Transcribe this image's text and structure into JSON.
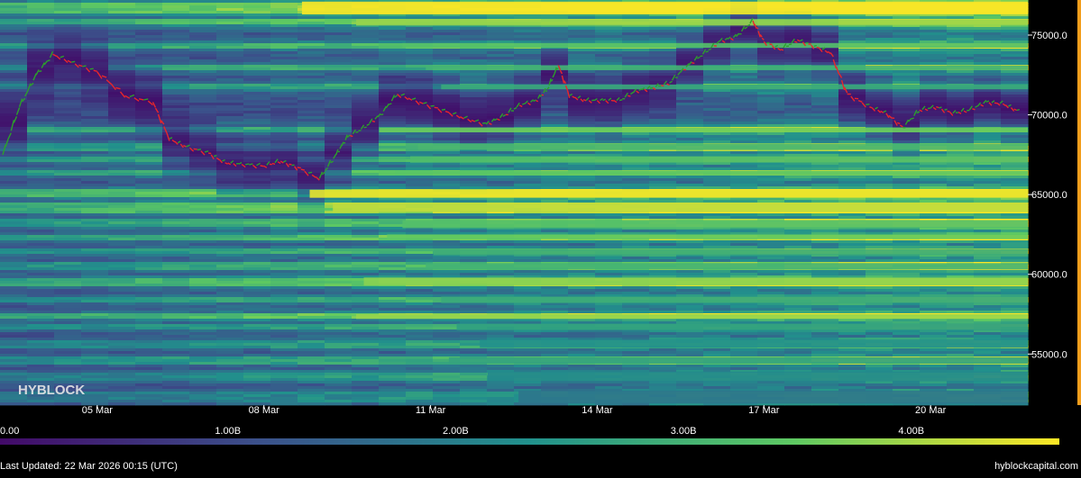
{
  "watermark": "HYBLOCK",
  "footer": {
    "last_updated": "Last Updated: 22 Mar 2026 00:15 (UTC)",
    "site": "hyblockcapital.com"
  },
  "chart_data": {
    "type": "heatmap",
    "title": "",
    "xlabel": "",
    "ylabel": "",
    "x_ticks": [
      "05 Mar",
      "08 Mar",
      "11 Mar",
      "14 Mar",
      "17 Mar",
      "20 Mar"
    ],
    "x_range_days": [
      3.25,
      21.75
    ],
    "y_ticks": [
      "55000.0",
      "60000.0",
      "65000.0",
      "70000.0",
      "75000.0"
    ],
    "y_tick_values": [
      55000,
      60000,
      65000,
      70000,
      75000
    ],
    "ylim": [
      51800,
      77200
    ],
    "colorbar": {
      "ticks": [
        "0.00",
        "1.00B",
        "2.00B",
        "3.00B",
        "4.00B"
      ],
      "tick_values": [
        0,
        1000000000,
        2000000000,
        3000000000,
        4000000000
      ],
      "max": 4650000000,
      "colors": [
        "#420a68",
        "#3b528b",
        "#21918c",
        "#5ec962",
        "#fde725"
      ]
    },
    "price_series": {
      "color_up": "#2ca02c",
      "color_down": "#e8262b",
      "x_days": [
        3.3,
        3.6,
        3.9,
        4.2,
        4.6,
        5.0,
        5.5,
        6.0,
        6.3,
        6.6,
        7.0,
        7.3,
        7.6,
        8.0,
        8.3,
        8.6,
        9.0,
        9.3,
        9.5,
        9.8,
        10.1,
        10.4,
        10.8,
        11.2,
        11.6,
        12.0,
        12.3,
        12.6,
        12.9,
        13.1,
        13.3,
        13.5,
        13.8,
        14.1,
        14.4,
        14.7,
        15.0,
        15.3,
        15.6,
        15.9,
        16.2,
        16.5,
        16.8,
        17.0,
        17.3,
        17.6,
        17.9,
        18.2,
        18.5,
        18.9,
        19.2,
        19.5,
        19.8,
        20.1,
        20.4,
        20.7,
        21.0,
        21.3,
        21.6
      ],
      "price": [
        67500,
        70500,
        72500,
        73800,
        73200,
        72700,
        71200,
        70800,
        68500,
        68000,
        67600,
        67000,
        66900,
        66800,
        67100,
        66700,
        66000,
        67500,
        68600,
        69200,
        70000,
        71300,
        70800,
        70300,
        69800,
        69400,
        69900,
        70600,
        70900,
        71600,
        73100,
        71200,
        70900,
        70900,
        70900,
        71500,
        71700,
        72000,
        73000,
        73800,
        74600,
        74900,
        75900,
        74600,
        74100,
        74700,
        74300,
        73900,
        71300,
        70500,
        70100,
        69200,
        70300,
        70500,
        70100,
        70300,
        70800,
        70700,
        70200
      ]
    },
    "liquidation_zones": [
      {
        "low": 51900,
        "high": 52700,
        "value": 1800000000
      },
      {
        "low": 53300,
        "high": 53900,
        "value": 2200000000
      },
      {
        "low": 54400,
        "high": 54800,
        "value": 2700000000
      },
      {
        "low": 55400,
        "high": 55900,
        "value": 2300000000
      },
      {
        "low": 56500,
        "high": 56900,
        "value": 2600000000
      },
      {
        "low": 57200,
        "high": 57500,
        "value": 3900000000
      },
      {
        "low": 58200,
        "high": 58600,
        "value": 2800000000
      },
      {
        "low": 59300,
        "high": 59800,
        "value": 3800000000
      },
      {
        "low": 60300,
        "high": 60700,
        "value": 3000000000
      },
      {
        "low": 61200,
        "high": 61600,
        "value": 2900000000
      },
      {
        "low": 62200,
        "high": 62500,
        "value": 3500000000
      },
      {
        "low": 62900,
        "high": 63400,
        "value": 3300000000
      },
      {
        "low": 63900,
        "high": 64500,
        "value": 4200000000
      },
      {
        "low": 64800,
        "high": 65300,
        "value": 4500000000
      },
      {
        "low": 66200,
        "high": 66500,
        "value": 3400000000
      },
      {
        "low": 67000,
        "high": 67400,
        "value": 3200000000
      },
      {
        "low": 67800,
        "high": 68200,
        "value": 3100000000
      },
      {
        "low": 68900,
        "high": 69200,
        "value": 3600000000
      },
      {
        "low": 71600,
        "high": 71900,
        "value": 2800000000
      },
      {
        "low": 72800,
        "high": 73100,
        "value": 3000000000
      },
      {
        "low": 74200,
        "high": 74500,
        "value": 3300000000
      },
      {
        "low": 75600,
        "high": 76000,
        "value": 3900000000
      },
      {
        "low": 76300,
        "high": 77100,
        "value": 4600000000
      }
    ]
  }
}
